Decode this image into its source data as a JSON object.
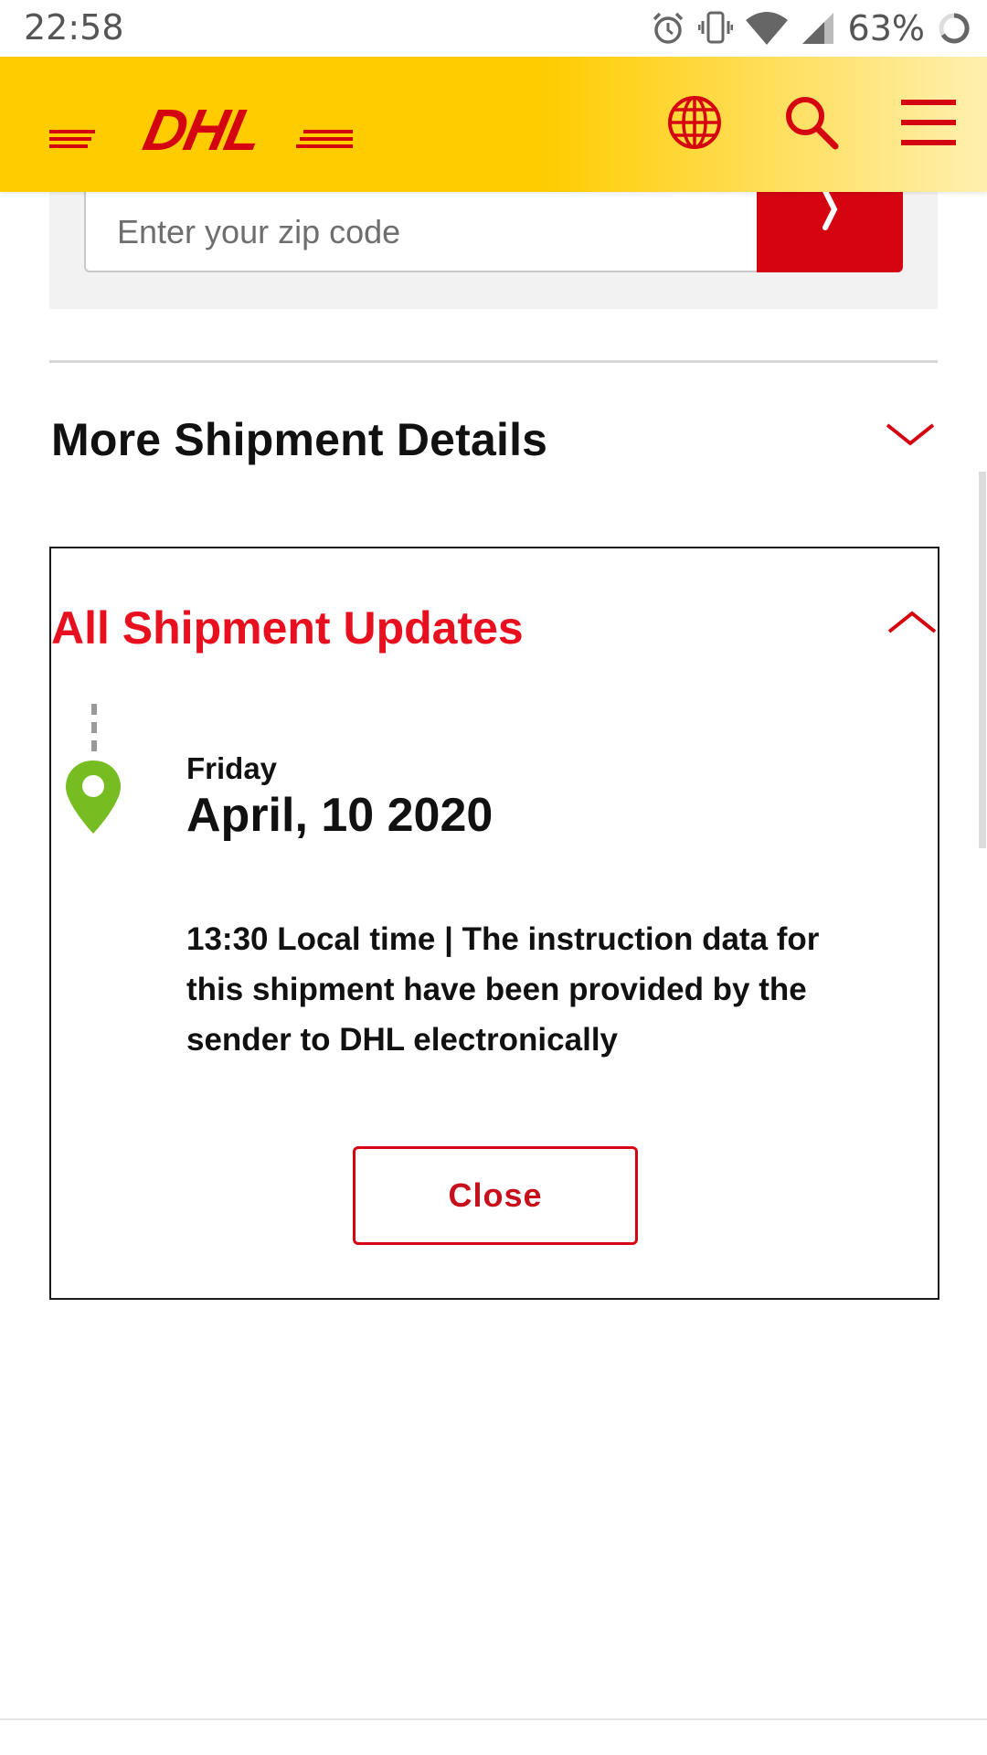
{
  "status_bar": {
    "time": "22:58",
    "battery_percent": "63%",
    "icons": [
      "alarm-icon",
      "vibrate-icon",
      "wifi-icon",
      "cell-signal-icon",
      "battery-icon"
    ]
  },
  "header": {
    "brand": "DHL",
    "brand_color": "#d40511",
    "background_color": "#ffcc00",
    "icons": [
      "globe-icon",
      "search-icon",
      "menu-icon"
    ]
  },
  "zip": {
    "placeholder": "Enter your zip code",
    "submit_icon": "chevron-right-icon"
  },
  "more_details": {
    "title": "More Shipment Details",
    "toggle_icon": "chevron-down-icon"
  },
  "updates": {
    "title": "All Shipment Updates",
    "title_color": "#e8101e",
    "toggle_icon": "chevron-up-icon",
    "events": [
      {
        "day": "Friday",
        "date": "April, 10 2020",
        "description": "13:30 Local time | The instruction data for this shipment have been provided by the sender to DHL electronically",
        "pin_color": "#76bd22"
      }
    ],
    "close_label": "Close"
  }
}
